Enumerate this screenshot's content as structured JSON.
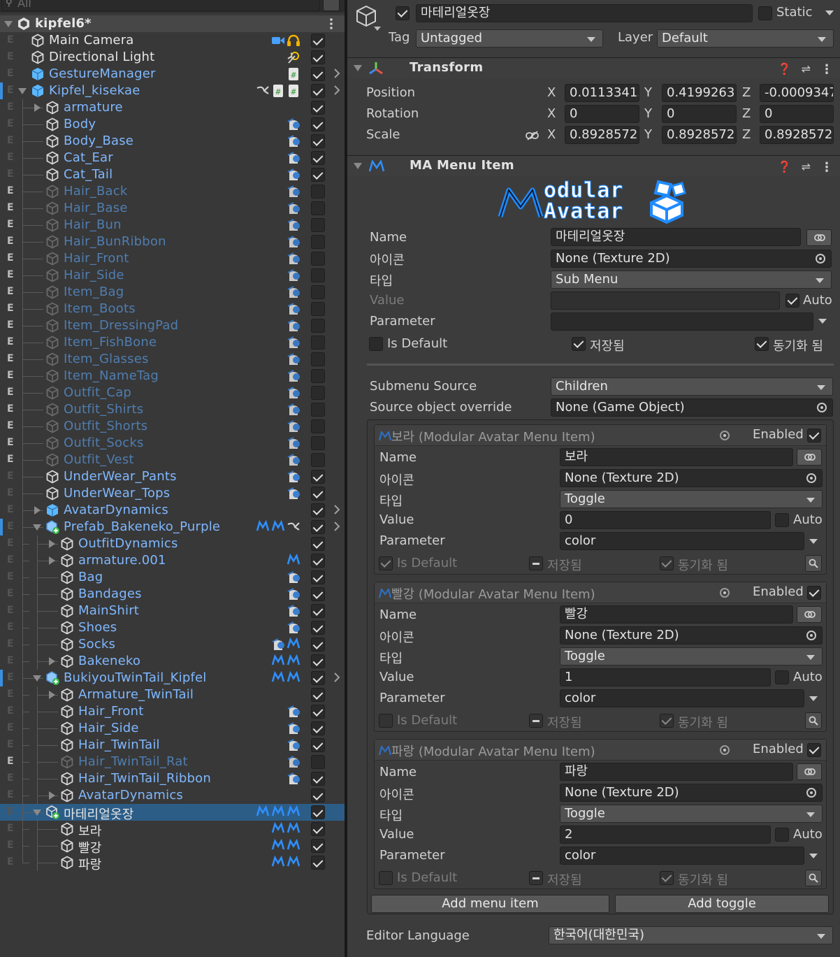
{
  "hierarchy": {
    "search_placeholder": "All",
    "scene_name": "kipfel6*",
    "rows": [
      {
        "label": "Main Camera",
        "indent": 0,
        "icon": "gameobject",
        "color": "white",
        "checked": true,
        "eflag": "E",
        "eon": false,
        "right_icons": [
          "camera-icon",
          "audio-listener-icon"
        ],
        "fold": "none",
        "sub_arrow": false
      },
      {
        "label": "Directional Light",
        "indent": 0,
        "icon": "gameobject",
        "color": "white",
        "checked": true,
        "eflag": "E",
        "eon": false,
        "right_icons": [
          "light-icon"
        ],
        "fold": "none",
        "sub_arrow": false
      },
      {
        "label": "GestureManager",
        "indent": 0,
        "icon": "prefab",
        "color": "blue",
        "checked": true,
        "eflag": "E",
        "eon": false,
        "right_icons": [
          "script-icon"
        ],
        "fold": "none",
        "sub_arrow": true
      },
      {
        "label": "Kipfel_kisekae",
        "indent": 0,
        "icon": "prefab-model",
        "color": "blue",
        "checked": true,
        "eflag": "E",
        "eon": false,
        "right_icons": [
          "animator-icon",
          "script-icon",
          "script-icon"
        ],
        "fold": "down",
        "sub_arrow": true,
        "bar": true
      },
      {
        "label": "armature",
        "indent": 1,
        "icon": "gameobject",
        "color": "blue",
        "checked": true,
        "eflag": "E",
        "eon": false,
        "right_icons": [],
        "fold": "right",
        "sub_arrow": false
      },
      {
        "label": "Body",
        "indent": 1,
        "icon": "gameobject",
        "color": "blue",
        "checked": true,
        "eflag": "E",
        "eon": false,
        "right_icons": [
          "skinned-mesh-icon"
        ],
        "fold": "none",
        "sub_arrow": false
      },
      {
        "label": "Body_Base",
        "indent": 1,
        "icon": "gameobject",
        "color": "blue",
        "checked": true,
        "eflag": "E",
        "eon": false,
        "right_icons": [
          "skinned-mesh-icon"
        ],
        "fold": "none",
        "sub_arrow": false
      },
      {
        "label": "Cat_Ear",
        "indent": 1,
        "icon": "gameobject",
        "color": "blue",
        "checked": true,
        "eflag": "E",
        "eon": false,
        "right_icons": [
          "skinned-mesh-icon"
        ],
        "fold": "none",
        "sub_arrow": false
      },
      {
        "label": "Cat_Tail",
        "indent": 1,
        "icon": "gameobject",
        "color": "blue",
        "checked": true,
        "eflag": "E",
        "eon": false,
        "right_icons": [
          "skinned-mesh-icon"
        ],
        "fold": "none",
        "sub_arrow": false
      },
      {
        "label": "Hair_Back",
        "indent": 1,
        "icon": "gameobject",
        "color": "dim",
        "checked": false,
        "eflag": "E",
        "eon": true,
        "right_icons": [
          "skinned-mesh-icon"
        ],
        "fold": "none",
        "sub_arrow": false
      },
      {
        "label": "Hair_Base",
        "indent": 1,
        "icon": "gameobject",
        "color": "dim",
        "checked": false,
        "eflag": "E",
        "eon": true,
        "right_icons": [
          "skinned-mesh-icon"
        ],
        "fold": "none",
        "sub_arrow": false
      },
      {
        "label": "Hair_Bun",
        "indent": 1,
        "icon": "gameobject",
        "color": "dim",
        "checked": false,
        "eflag": "E",
        "eon": true,
        "right_icons": [
          "skinned-mesh-icon"
        ],
        "fold": "none",
        "sub_arrow": false
      },
      {
        "label": "Hair_BunRibbon",
        "indent": 1,
        "icon": "gameobject",
        "color": "dim",
        "checked": false,
        "eflag": "E",
        "eon": true,
        "right_icons": [
          "skinned-mesh-icon"
        ],
        "fold": "none",
        "sub_arrow": false
      },
      {
        "label": "Hair_Front",
        "indent": 1,
        "icon": "gameobject",
        "color": "dim",
        "checked": false,
        "eflag": "E",
        "eon": true,
        "right_icons": [
          "skinned-mesh-icon"
        ],
        "fold": "none",
        "sub_arrow": false
      },
      {
        "label": "Hair_Side",
        "indent": 1,
        "icon": "gameobject",
        "color": "dim",
        "checked": false,
        "eflag": "E",
        "eon": true,
        "right_icons": [
          "skinned-mesh-icon"
        ],
        "fold": "none",
        "sub_arrow": false
      },
      {
        "label": "Item_Bag",
        "indent": 1,
        "icon": "gameobject",
        "color": "dim",
        "checked": false,
        "eflag": "E",
        "eon": true,
        "right_icons": [
          "skinned-mesh-icon"
        ],
        "fold": "none",
        "sub_arrow": false
      },
      {
        "label": "Item_Boots",
        "indent": 1,
        "icon": "gameobject",
        "color": "dim",
        "checked": false,
        "eflag": "E",
        "eon": true,
        "right_icons": [
          "skinned-mesh-icon"
        ],
        "fold": "none",
        "sub_arrow": false
      },
      {
        "label": "Item_DressingPad",
        "indent": 1,
        "icon": "gameobject",
        "color": "dim",
        "checked": false,
        "eflag": "E",
        "eon": true,
        "right_icons": [
          "skinned-mesh-icon"
        ],
        "fold": "none",
        "sub_arrow": false
      },
      {
        "label": "Item_FishBone",
        "indent": 1,
        "icon": "gameobject",
        "color": "dim",
        "checked": false,
        "eflag": "E",
        "eon": true,
        "right_icons": [
          "skinned-mesh-icon"
        ],
        "fold": "none",
        "sub_arrow": false
      },
      {
        "label": "Item_Glasses",
        "indent": 1,
        "icon": "gameobject",
        "color": "dim",
        "checked": false,
        "eflag": "E",
        "eon": true,
        "right_icons": [
          "skinned-mesh-icon"
        ],
        "fold": "none",
        "sub_arrow": false
      },
      {
        "label": "Item_NameTag",
        "indent": 1,
        "icon": "gameobject",
        "color": "dim",
        "checked": false,
        "eflag": "E",
        "eon": true,
        "right_icons": [
          "skinned-mesh-icon"
        ],
        "fold": "none",
        "sub_arrow": false
      },
      {
        "label": "Outfit_Cap",
        "indent": 1,
        "icon": "gameobject",
        "color": "dim",
        "checked": false,
        "eflag": "E",
        "eon": true,
        "right_icons": [
          "skinned-mesh-icon"
        ],
        "fold": "none",
        "sub_arrow": false
      },
      {
        "label": "Outfit_Shirts",
        "indent": 1,
        "icon": "gameobject",
        "color": "dim",
        "checked": false,
        "eflag": "E",
        "eon": true,
        "right_icons": [
          "skinned-mesh-icon"
        ],
        "fold": "none",
        "sub_arrow": false
      },
      {
        "label": "Outfit_Shorts",
        "indent": 1,
        "icon": "gameobject",
        "color": "dim",
        "checked": false,
        "eflag": "E",
        "eon": true,
        "right_icons": [
          "skinned-mesh-icon"
        ],
        "fold": "none",
        "sub_arrow": false
      },
      {
        "label": "Outfit_Socks",
        "indent": 1,
        "icon": "gameobject",
        "color": "dim",
        "checked": false,
        "eflag": "E",
        "eon": true,
        "right_icons": [
          "skinned-mesh-icon"
        ],
        "fold": "none",
        "sub_arrow": false
      },
      {
        "label": "Outfit_Vest",
        "indent": 1,
        "icon": "gameobject",
        "color": "dim",
        "checked": false,
        "eflag": "E",
        "eon": true,
        "right_icons": [
          "skinned-mesh-icon"
        ],
        "fold": "none",
        "sub_arrow": false
      },
      {
        "label": "UnderWear_Pants",
        "indent": 1,
        "icon": "gameobject",
        "color": "blue",
        "checked": true,
        "eflag": "E",
        "eon": false,
        "right_icons": [
          "skinned-mesh-icon"
        ],
        "fold": "none",
        "sub_arrow": false
      },
      {
        "label": "UnderWear_Tops",
        "indent": 1,
        "icon": "gameobject",
        "color": "blue",
        "checked": true,
        "eflag": "E",
        "eon": false,
        "right_icons": [
          "skinned-mesh-icon"
        ],
        "fold": "none",
        "sub_arrow": false
      },
      {
        "label": "AvatarDynamics",
        "indent": 1,
        "icon": "prefab",
        "color": "blue",
        "checked": true,
        "eflag": "E",
        "eon": false,
        "right_icons": [],
        "fold": "right",
        "sub_arrow": true
      },
      {
        "label": "Prefab_Bakeneko_Purple",
        "indent": 1,
        "icon": "prefab-added",
        "color": "blue",
        "checked": true,
        "eflag": "E",
        "eon": false,
        "right_icons": [
          "ma-icon",
          "ma-icon",
          "animator-icon"
        ],
        "fold": "down",
        "sub_arrow": true,
        "bar": true
      },
      {
        "label": "OutfitDynamics",
        "indent": 2,
        "icon": "gameobject",
        "color": "blue",
        "checked": true,
        "eflag": "E",
        "eon": false,
        "right_icons": [],
        "fold": "right",
        "sub_arrow": false
      },
      {
        "label": "armature.001",
        "indent": 2,
        "icon": "gameobject",
        "color": "blue",
        "checked": true,
        "eflag": "E",
        "eon": false,
        "right_icons": [
          "ma-icon"
        ],
        "fold": "right",
        "sub_arrow": false
      },
      {
        "label": "Bag",
        "indent": 2,
        "icon": "gameobject",
        "color": "blue",
        "checked": true,
        "eflag": "E",
        "eon": false,
        "right_icons": [
          "skinned-mesh-icon"
        ],
        "fold": "none",
        "sub_arrow": false
      },
      {
        "label": "Bandages",
        "indent": 2,
        "icon": "gameobject",
        "color": "blue",
        "checked": true,
        "eflag": "E",
        "eon": false,
        "right_icons": [
          "skinned-mesh-icon"
        ],
        "fold": "none",
        "sub_arrow": false
      },
      {
        "label": "MainShirt",
        "indent": 2,
        "icon": "gameobject",
        "color": "blue",
        "checked": true,
        "eflag": "E",
        "eon": false,
        "right_icons": [
          "skinned-mesh-icon"
        ],
        "fold": "none",
        "sub_arrow": false
      },
      {
        "label": "Shoes",
        "indent": 2,
        "icon": "gameobject",
        "color": "blue",
        "checked": true,
        "eflag": "E",
        "eon": false,
        "right_icons": [
          "skinned-mesh-icon"
        ],
        "fold": "none",
        "sub_arrow": false
      },
      {
        "label": "Socks",
        "indent": 2,
        "icon": "gameobject",
        "color": "blue",
        "checked": true,
        "eflag": "E",
        "eon": false,
        "right_icons": [
          "skinned-mesh-icon",
          "ma-icon"
        ],
        "fold": "none",
        "sub_arrow": false
      },
      {
        "label": "Bakeneko",
        "indent": 2,
        "icon": "gameobject",
        "color": "blue",
        "checked": true,
        "eflag": "E",
        "eon": false,
        "right_icons": [
          "ma-icon",
          "ma-icon"
        ],
        "fold": "right",
        "sub_arrow": false
      },
      {
        "label": "BukiyouTwinTail_Kipfel",
        "indent": 1,
        "icon": "prefab-added",
        "color": "blue",
        "checked": true,
        "eflag": "E",
        "eon": false,
        "right_icons": [
          "ma-icon",
          "ma-icon"
        ],
        "fold": "down",
        "sub_arrow": true,
        "bar": true
      },
      {
        "label": "Armature_TwinTail",
        "indent": 2,
        "icon": "gameobject",
        "color": "blue",
        "checked": true,
        "eflag": "E",
        "eon": false,
        "right_icons": [],
        "fold": "right",
        "sub_arrow": false
      },
      {
        "label": "Hair_Front",
        "indent": 2,
        "icon": "gameobject",
        "color": "blue",
        "checked": true,
        "eflag": "E",
        "eon": false,
        "right_icons": [
          "skinned-mesh-icon"
        ],
        "fold": "none",
        "sub_arrow": false
      },
      {
        "label": "Hair_Side",
        "indent": 2,
        "icon": "gameobject",
        "color": "blue",
        "checked": true,
        "eflag": "E",
        "eon": false,
        "right_icons": [
          "skinned-mesh-icon"
        ],
        "fold": "none",
        "sub_arrow": false
      },
      {
        "label": "Hair_TwinTail",
        "indent": 2,
        "icon": "gameobject",
        "color": "blue",
        "checked": true,
        "eflag": "E",
        "eon": false,
        "right_icons": [
          "skinned-mesh-icon"
        ],
        "fold": "none",
        "sub_arrow": false
      },
      {
        "label": "Hair_TwinTail_Rat",
        "indent": 2,
        "icon": "gameobject",
        "color": "dim",
        "checked": false,
        "eflag": "E",
        "eon": true,
        "right_icons": [
          "skinned-mesh-icon"
        ],
        "fold": "none",
        "sub_arrow": false
      },
      {
        "label": "Hair_TwinTail_Ribbon",
        "indent": 2,
        "icon": "gameobject",
        "color": "blue",
        "checked": true,
        "eflag": "E",
        "eon": false,
        "right_icons": [
          "skinned-mesh-icon"
        ],
        "fold": "none",
        "sub_arrow": false
      },
      {
        "label": "AvatarDynamics",
        "indent": 2,
        "icon": "gameobject",
        "color": "blue",
        "checked": true,
        "eflag": "E",
        "eon": false,
        "right_icons": [],
        "fold": "right",
        "sub_arrow": false
      },
      {
        "label": "마테리얼옷장",
        "indent": 1,
        "icon": "gameobject-added",
        "color": "white",
        "checked": true,
        "eflag": "E",
        "eon": false,
        "right_icons": [
          "ma-icon",
          "ma-icon",
          "ma-icon"
        ],
        "fold": "down",
        "sub_arrow": false,
        "selected": true
      },
      {
        "label": "보라",
        "indent": 2,
        "icon": "gameobject",
        "color": "white",
        "checked": true,
        "eflag": "E",
        "eon": false,
        "right_icons": [
          "ma-icon",
          "ma-icon"
        ],
        "fold": "none",
        "sub_arrow": false
      },
      {
        "label": "빨강",
        "indent": 2,
        "icon": "gameobject",
        "color": "white",
        "checked": true,
        "eflag": "E",
        "eon": false,
        "right_icons": [
          "ma-icon",
          "ma-icon"
        ],
        "fold": "none",
        "sub_arrow": false
      },
      {
        "label": "파랑",
        "indent": 2,
        "icon": "gameobject",
        "color": "white",
        "checked": true,
        "eflag": "E",
        "eon": false,
        "right_icons": [
          "ma-icon",
          "ma-icon"
        ],
        "fold": "none",
        "sub_arrow": false
      }
    ]
  },
  "inspector": {
    "object_name": "마테리얼옷장",
    "active": true,
    "static_label": "Static",
    "tag_label": "Tag",
    "tag_value": "Untagged",
    "layer_label": "Layer",
    "layer_value": "Default",
    "transform": {
      "title": "Transform",
      "rows": [
        {
          "label": "Position",
          "x": "0.01133415",
          "y": "0.4199263",
          "z": "-0.0009347"
        },
        {
          "label": "Rotation",
          "x": "0",
          "y": "0",
          "z": "0"
        },
        {
          "label": "Scale",
          "x": "0.8928572",
          "y": "0.8928572",
          "z": "0.8928572"
        }
      ],
      "axis_x": "X",
      "axis_y": "Y",
      "axis_z": "Z"
    },
    "menu_item": {
      "title": "MA Menu Item",
      "logo_line1": "odular",
      "logo_line2": "Avatar",
      "name_label": "Name",
      "name_value": "마테리얼옷장",
      "icon_label": "아이콘",
      "icon_value": "None (Texture 2D)",
      "type_label": "타입",
      "type_value": "Sub Menu",
      "value_label": "Value",
      "value_value": "",
      "auto_label": "Auto",
      "parameter_label": "Parameter",
      "parameter_value": "",
      "is_default_label": "Is Default",
      "saved_label": "저장됨",
      "synced_label": "동기화 됨",
      "submenu_source_label": "Submenu Source",
      "submenu_source_value": "Children",
      "source_override_label": "Source object override",
      "source_override_value": "None (Game Object)",
      "enabled_label": "Enabled",
      "children": [
        {
          "header": "보라 (Modular Avatar Menu Item)",
          "name": "보라",
          "icon": "None (Texture 2D)",
          "type": "Toggle",
          "value": "0",
          "parameter": "color",
          "is_default": true
        },
        {
          "header": "빨강 (Modular Avatar Menu Item)",
          "name": "빨강",
          "icon": "None (Texture 2D)",
          "type": "Toggle",
          "value": "1",
          "parameter": "color",
          "is_default": false
        },
        {
          "header": "파랑 (Modular Avatar Menu Item)",
          "name": "파랑",
          "icon": "None (Texture 2D)",
          "type": "Toggle",
          "value": "2",
          "parameter": "color",
          "is_default": false
        }
      ],
      "add_menu_item": "Add menu item",
      "add_toggle": "Add toggle",
      "editor_language_label": "Editor Language",
      "editor_language_value": "한국어(대한민국)"
    }
  },
  "colors": {
    "hier_blue": "#7fb8ff",
    "hier_dim": "#4f7db0",
    "selected_row": "#2c5d87",
    "ma_icon": "#2e8fff"
  }
}
